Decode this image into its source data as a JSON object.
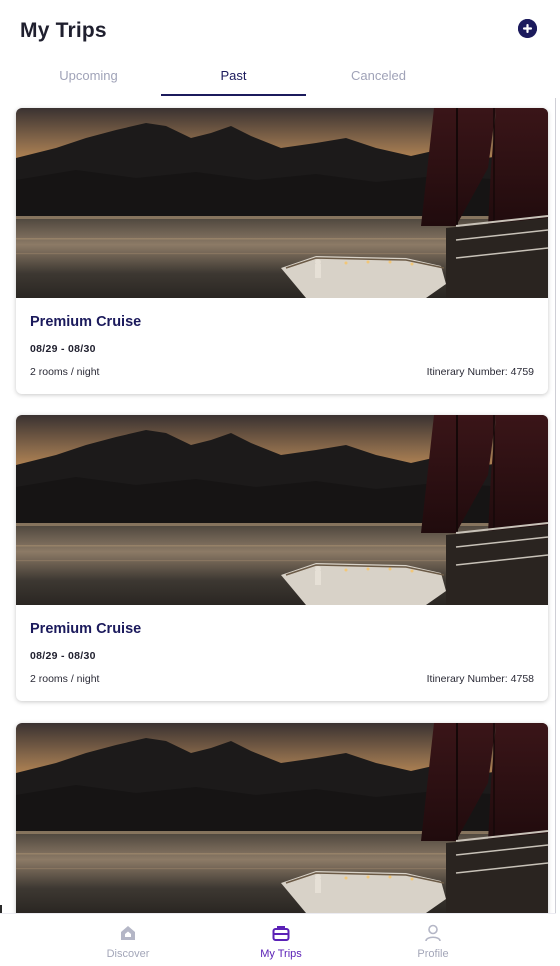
{
  "header": {
    "title": "My Trips",
    "add_icon": "plus-circle-icon"
  },
  "tabs": [
    {
      "label": "Upcoming",
      "active": false
    },
    {
      "label": "Past",
      "active": true
    },
    {
      "label": "Canceled",
      "active": false
    }
  ],
  "trips": [
    {
      "name": "Premium Cruise",
      "dates": "08/29 - 08/30",
      "rooms": "2 rooms / night",
      "itinerary": "Itinerary Number: 4759"
    },
    {
      "name": "Premium Cruise",
      "dates": "08/29 - 08/30",
      "rooms": "2 rooms / night",
      "itinerary": "Itinerary Number: 4758"
    },
    {
      "name": "",
      "dates": "",
      "rooms": "",
      "itinerary": ""
    }
  ],
  "bottom_nav": [
    {
      "label": "Discover",
      "icon": "home-icon",
      "active": false
    },
    {
      "label": "My Trips",
      "icon": "briefcase-icon",
      "active": true
    },
    {
      "label": "Profile",
      "icon": "person-icon",
      "active": false
    }
  ],
  "colors": {
    "primary": "#1b1a5c",
    "active_nav": "#5b21b6",
    "inactive": "#a0a3b8"
  }
}
